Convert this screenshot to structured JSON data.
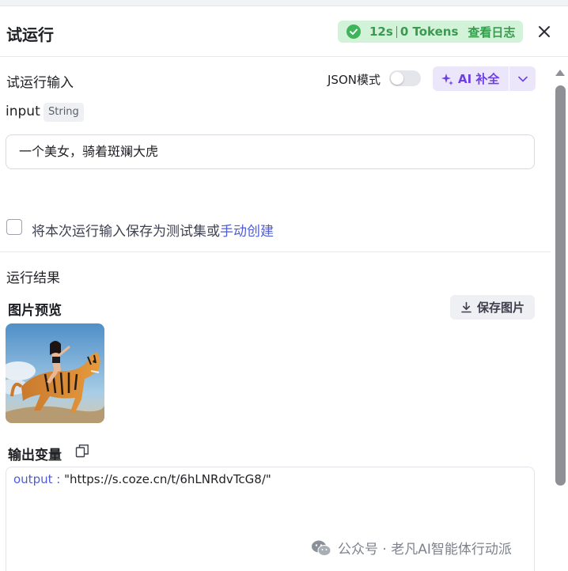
{
  "header": {
    "title": "试运行",
    "run_time": "12s",
    "tokens": "0 Tokens",
    "view_log": "查看日志",
    "status_color": "#3a9a50"
  },
  "input_section": {
    "title": "试运行输入",
    "json_mode_label": "JSON模式",
    "json_mode_on": false,
    "ai_fill_label": "AI 补全",
    "param_name": "input",
    "param_type": "String",
    "param_value": "一个美女，骑着斑斓大虎",
    "save_as_testset_text": "将本次运行输入保存为测试集或",
    "manual_create_link": "手动创建",
    "save_checked": false
  },
  "result_section": {
    "title": "运行结果",
    "image_preview_title": "图片预览",
    "save_image_label": "保存图片",
    "output_vars_title": "输出变量",
    "output_key": "output",
    "output_colon": " : ",
    "output_value": "\"https://s.coze.cn/t/6hLNRdvTcG8/\""
  },
  "watermark": {
    "text": "公众号 · 老凡AI智能体行动派"
  },
  "colors": {
    "accent": "#6d3fe1",
    "link": "#4e5bd6",
    "success_bg": "#d3f3d9"
  }
}
